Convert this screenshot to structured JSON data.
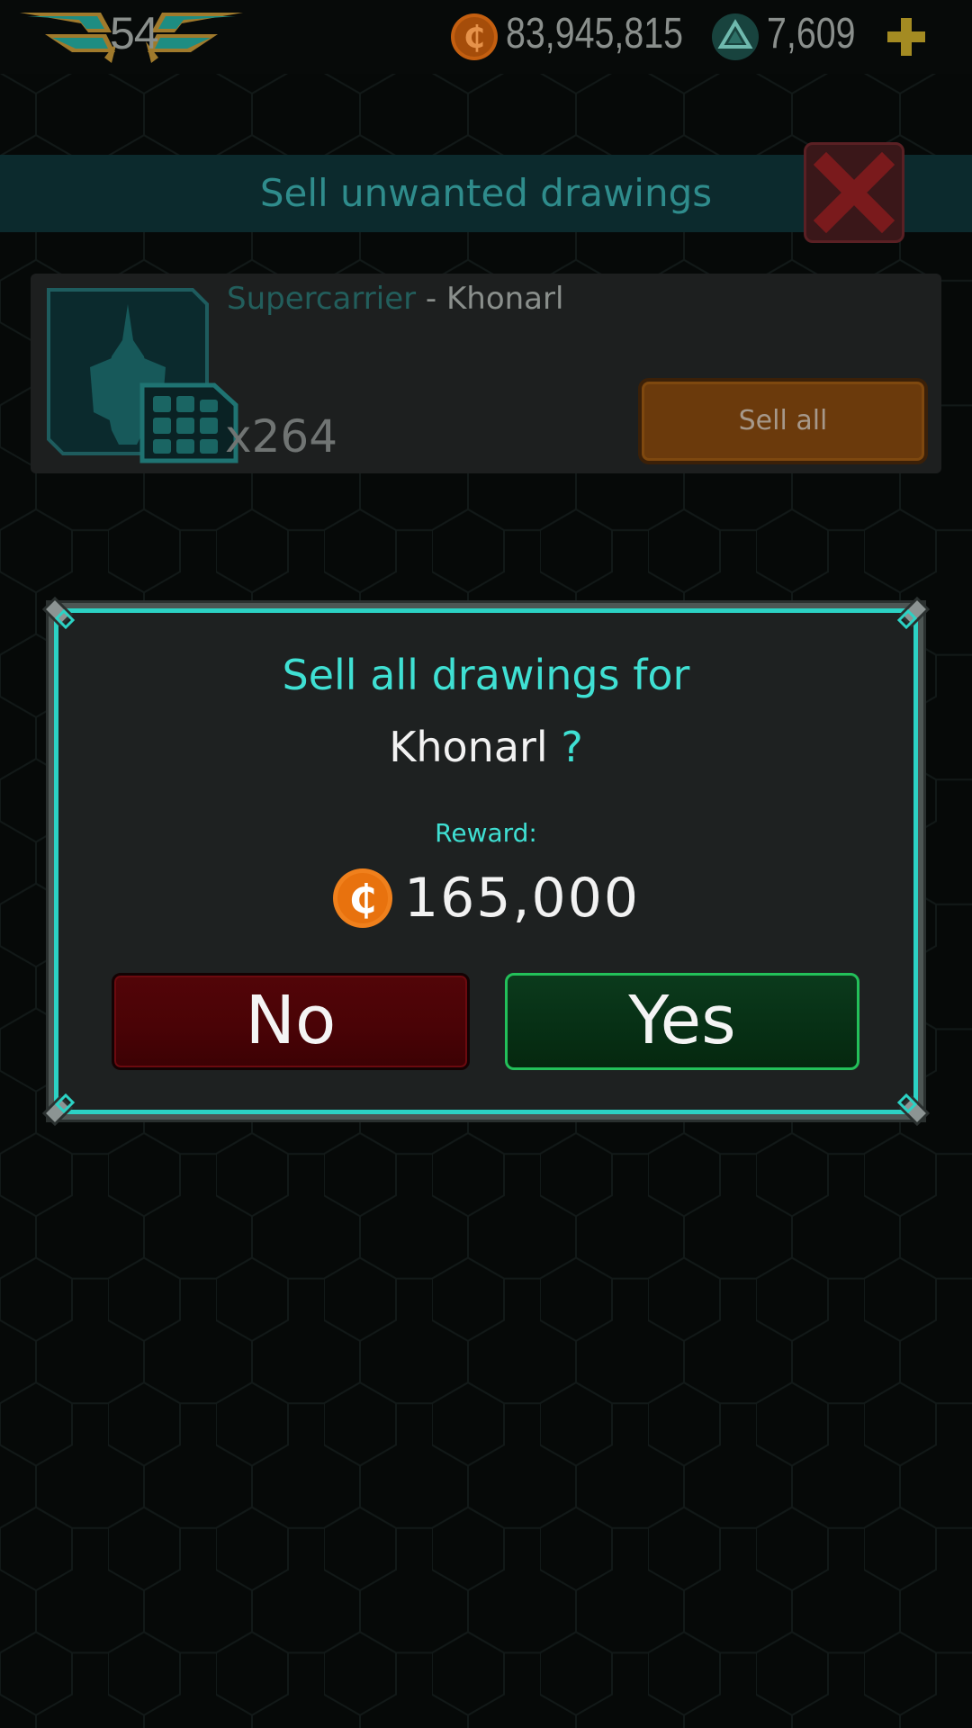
{
  "topbar": {
    "rank": "54",
    "credits": "83,945,815",
    "gems": "7,609",
    "icons": [
      "rank-wings-icon",
      "credit-coin-icon",
      "gem-triangle-icon",
      "plus-icon"
    ]
  },
  "panel": {
    "title": "Sell unwanted drawings",
    "close_icon": "close-x-icon"
  },
  "card": {
    "ship_class": "Supercarrier",
    "separator": " - ",
    "ship_name": "Khonarl",
    "count": "x264",
    "sell_all_label": "Sell all",
    "icons": [
      "ship-silhouette-icon",
      "blueprint-grid-icon"
    ]
  },
  "modal": {
    "line1": "Sell all drawings for",
    "ship_name": "Khonarl",
    "question_mark": "?",
    "reward_label": "Reward:",
    "reward_value": "165,000",
    "no_label": "No",
    "yes_label": "Yes"
  },
  "colors": {
    "accent_cyan": "#3fe0d3",
    "coin_orange": "#f0801c",
    "no_red": "#4a0306",
    "yes_green": "#073015",
    "yes_border": "#23c05a"
  }
}
